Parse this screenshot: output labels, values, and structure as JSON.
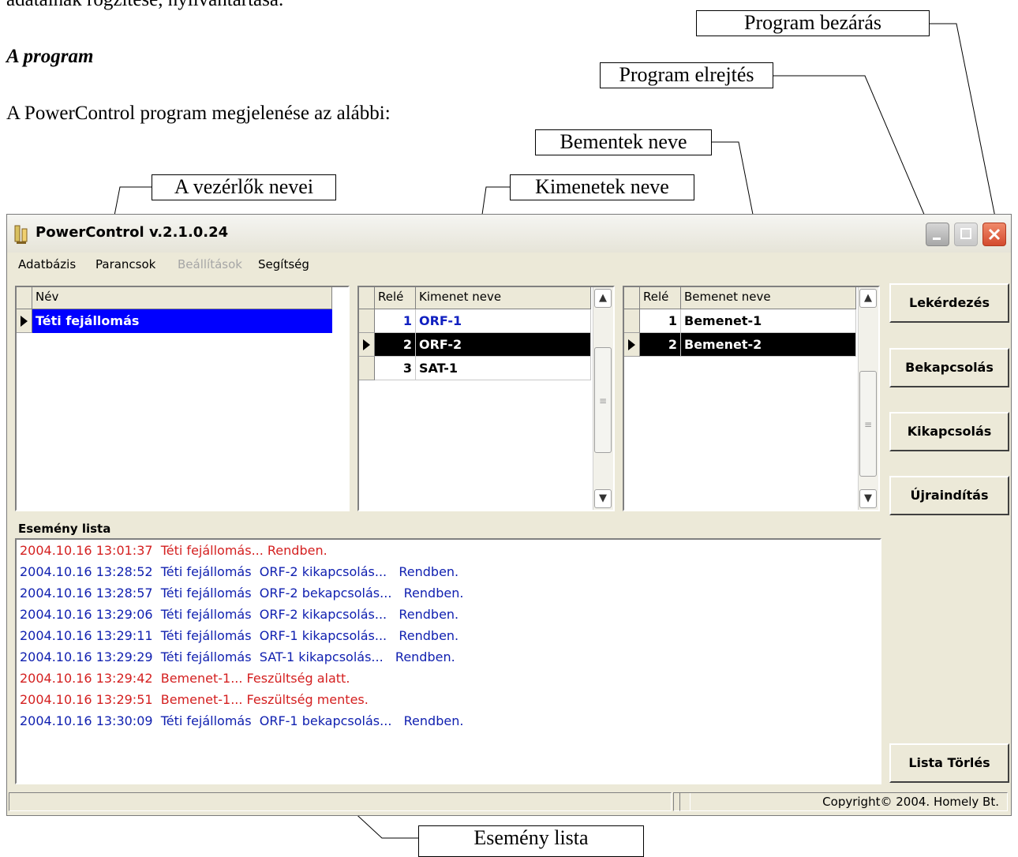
{
  "document": {
    "cut_line": "adatainak rögzítése, nyilvántartása.",
    "heading": "A program",
    "intro": "A PowerControl program megjelenése az alábbi:"
  },
  "callouts": {
    "close": "Program bezárás",
    "hide": "Program elrejtés",
    "inputs": "Bementek neve",
    "outputs": "Kimenetek neve",
    "controllers": "A vezérlők nevei",
    "eventlist": "Esemény lista"
  },
  "window": {
    "title": "PowerControl v.2.1.0.24",
    "menu": [
      "Adatbázis",
      "Parancsok",
      "Beállítások",
      "Segítség"
    ]
  },
  "controllers": {
    "header": "Név",
    "rows": [
      {
        "name": "Téti fejállomás"
      }
    ]
  },
  "outputs": {
    "headers": [
      "Relé",
      "Kimenet neve"
    ],
    "rows": [
      {
        "rele": "1",
        "name": "ORF-1"
      },
      {
        "rele": "2",
        "name": "ORF-2"
      },
      {
        "rele": "3",
        "name": "SAT-1"
      }
    ]
  },
  "inputs": {
    "headers": [
      "Relé",
      "Bemenet neve"
    ],
    "rows": [
      {
        "rele": "1",
        "name": "Bemenet-1"
      },
      {
        "rele": "2",
        "name": "Bemenet-2"
      }
    ]
  },
  "buttons": {
    "query": "Lekérdezés",
    "on": "Bekapcsolás",
    "off": "Kikapcsolás",
    "restart": "Újraindítás",
    "clear": "Lista Törlés"
  },
  "log": {
    "label": "Esemény lista",
    "entries": [
      "2004.10.16 13:01:37  Téti fejállomás... Rendben.",
      "2004.10.16 13:28:52  Téti fejállomás  ORF-2 kikapcsolás...   Rendben.",
      "2004.10.16 13:28:57  Téti fejállomás  ORF-2 bekapcsolás...   Rendben.",
      "2004.10.16 13:29:06  Téti fejállomás  ORF-2 kikapcsolás...   Rendben.",
      "2004.10.16 13:29:11  Téti fejállomás  ORF-1 kikapcsolás...   Rendben.",
      "2004.10.16 13:29:29  Téti fejállomás  SAT-1 kikapcsolás...   Rendben.",
      "2004.10.16 13:29:42  Bemenet-1... Feszültség alatt.",
      "2004.10.16 13:29:51  Bemenet-1... Feszültség mentes.",
      "2004.10.16 13:30:09  Téti fejállomás  ORF-1 bekapcsolás...   Rendben."
    ]
  },
  "status": {
    "copyright": "Copyright© 2004.  Homely Bt."
  },
  "colors": {
    "log_red": "#d42020",
    "log_blue": "#1020b0",
    "selection_blue": "#0000ff"
  }
}
